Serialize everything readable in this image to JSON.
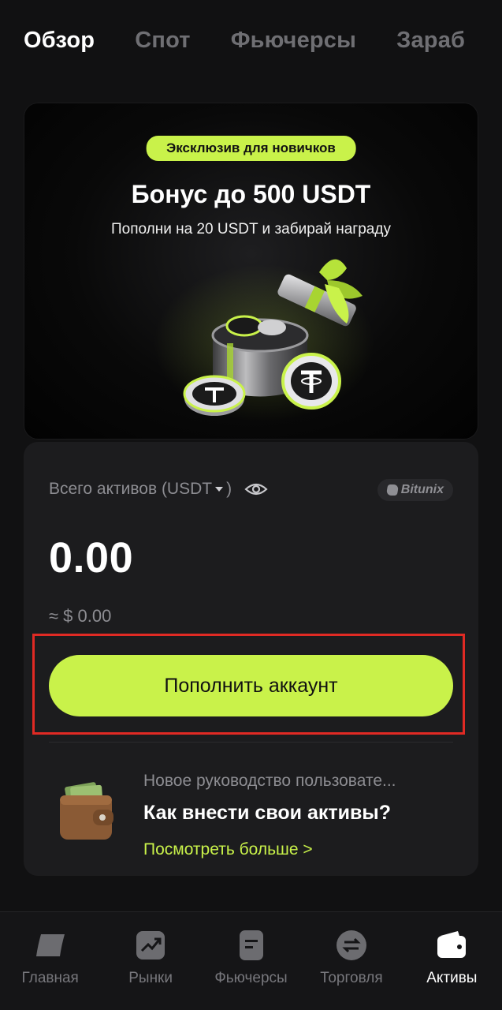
{
  "top_tabs": [
    {
      "label": "Обзор",
      "active": true
    },
    {
      "label": "Спот",
      "active": false
    },
    {
      "label": "Фьючерсы",
      "active": false
    },
    {
      "label": "Зараб",
      "active": false
    }
  ],
  "banner": {
    "badge": "Эксклюзив для новичков",
    "title": "Бонус до 500 USDT",
    "subtitle": "Пополни на 20 USDT и забирай награду",
    "image_icon": "usdt-gift-box-icon"
  },
  "assets": {
    "label": "Всего активов (USDT",
    "label_close": ")",
    "currency": "USDT",
    "brand": "Bitunix",
    "value": "0.00",
    "approx": "≈ $ 0.00",
    "deposit_label": "Пополнить аккаунт"
  },
  "guide": {
    "kicker": "Новое руководство пользовате...",
    "title": "Как внести свои активы?",
    "more": "Посмотреть больше >"
  },
  "bottom_nav": [
    {
      "label": "Главная",
      "icon": "home-icon",
      "active": false
    },
    {
      "label": "Рынки",
      "icon": "markets-chart-icon",
      "active": false
    },
    {
      "label": "Фьючерсы",
      "icon": "futures-document-icon",
      "active": false
    },
    {
      "label": "Торговля",
      "icon": "trade-swap-icon",
      "active": false
    },
    {
      "label": "Активы",
      "icon": "wallet-icon",
      "active": true
    }
  ],
  "colors": {
    "accent": "#c9f24a",
    "background": "#111112",
    "card": "#1c1c1e",
    "highlight_border": "#e02a24"
  }
}
